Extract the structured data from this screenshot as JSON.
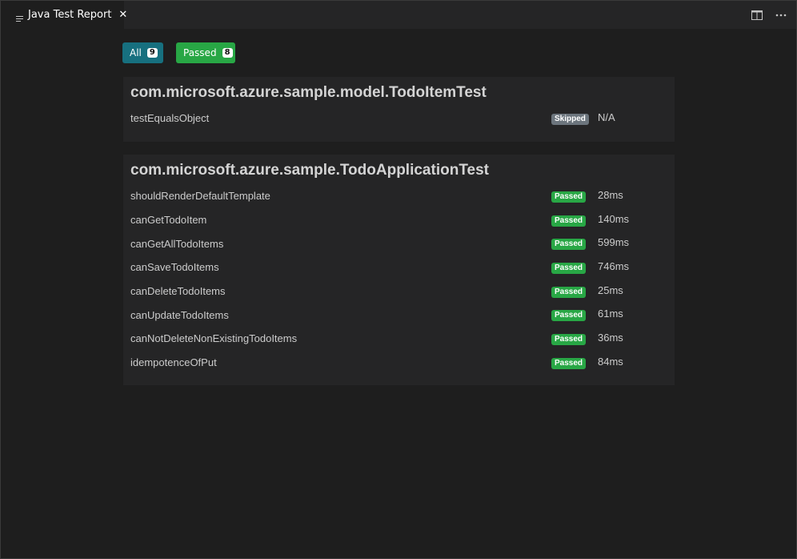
{
  "tab": {
    "title": "Java Test Report",
    "close_glyph": "✕"
  },
  "filters": {
    "all_label": "All",
    "all_count": "9",
    "passed_label": "Passed",
    "passed_count": "8"
  },
  "classes": [
    {
      "name": "com.microsoft.azure.sample.model.TodoItemTest",
      "tests": [
        {
          "name": "testEqualsObject",
          "status": "Skipped",
          "duration": "N/A"
        }
      ]
    },
    {
      "name": "com.microsoft.azure.sample.TodoApplicationTest",
      "tests": [
        {
          "name": "shouldRenderDefaultTemplate",
          "status": "Passed",
          "duration": "28ms"
        },
        {
          "name": "canGetTodoItem",
          "status": "Passed",
          "duration": "140ms"
        },
        {
          "name": "canGetAllTodoItems",
          "status": "Passed",
          "duration": "599ms"
        },
        {
          "name": "canSaveTodoItems",
          "status": "Passed",
          "duration": "746ms"
        },
        {
          "name": "canDeleteTodoItems",
          "status": "Passed",
          "duration": "25ms"
        },
        {
          "name": "canUpdateTodoItems",
          "status": "Passed",
          "duration": "61ms"
        },
        {
          "name": "canNotDeleteNonExistingTodoItems",
          "status": "Passed",
          "duration": "36ms"
        },
        {
          "name": "idempotenceOfPut",
          "status": "Passed",
          "duration": "84ms"
        }
      ]
    }
  ],
  "colors": {
    "all_filter": "#17707f",
    "passed": "#28a745",
    "skipped": "#6c757d",
    "background": "#1e1e1e",
    "card": "#252526"
  },
  "icons": {
    "tab": "preview-lines-icon",
    "split": "split-editor-icon",
    "more": "more-actions-icon"
  }
}
